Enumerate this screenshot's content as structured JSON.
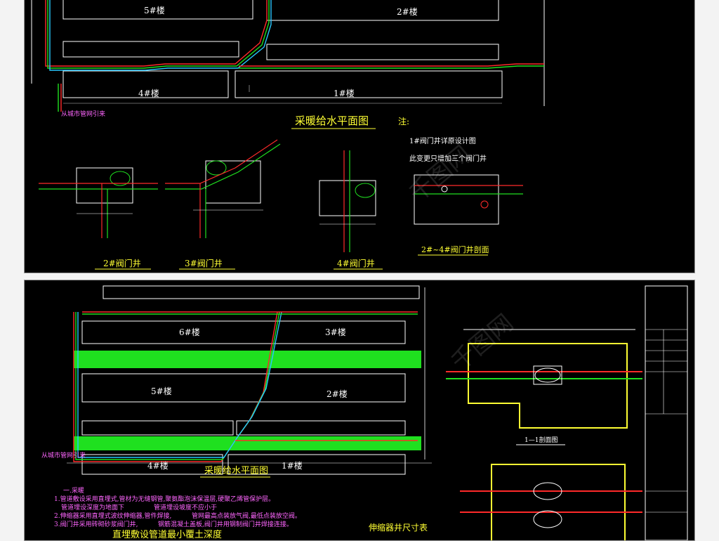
{
  "top_sheet": {
    "buildings": {
      "b5": "5#楼",
      "b2": "2#楼",
      "b4": "4#楼",
      "b1": "1#楼"
    },
    "city_pipe_note": "从城市管网引来",
    "plan_title": "采暖给水平面图",
    "notes_label": "注:",
    "note_1": "1#阀门井详原设计图",
    "note_2": "此变更只增加三个阀门井",
    "well_2": "2#阀门井",
    "well_3": "3#阀门井",
    "well_4": "4#阀门井",
    "section_title": "2#~4#阀门井剖面"
  },
  "bottom_sheet": {
    "buildings": {
      "b6": "6#楼",
      "b3": "3#楼",
      "b5": "5#楼",
      "b2": "2#楼",
      "b4": "4#楼",
      "b1": "1#楼"
    },
    "city_pipe_note": "从城市管网引来",
    "plan_title": "采暖给水平面图",
    "section_label": "1—1剖面图",
    "notes_heading": "一.采暖",
    "note_1": "1.管道敷设采用直埋式,管材为无缝钢管,聚氨酯泡沫保温层,硬聚乙烯管保护层。",
    "note_1b": "管道埋设深度为地面下",
    "note_1c": "管道埋设坡度不应小于",
    "note_2": "2.伸缩器采用直埋式波纹伸缩器,管件焊接,",
    "note_2b": "管网最高点装放气阀,最低点装放空阀。",
    "note_3": "3.阀门井采用砖砌砂浆阀门井,",
    "note_3b": "钢筋混凝土盖板,阀门井用钢制阀门井焊接连接。",
    "table_title": "伸缩器井尺寸表",
    "bottom_title": "直埋敷设管道最小覆土深度"
  },
  "watermark": "千图网"
}
